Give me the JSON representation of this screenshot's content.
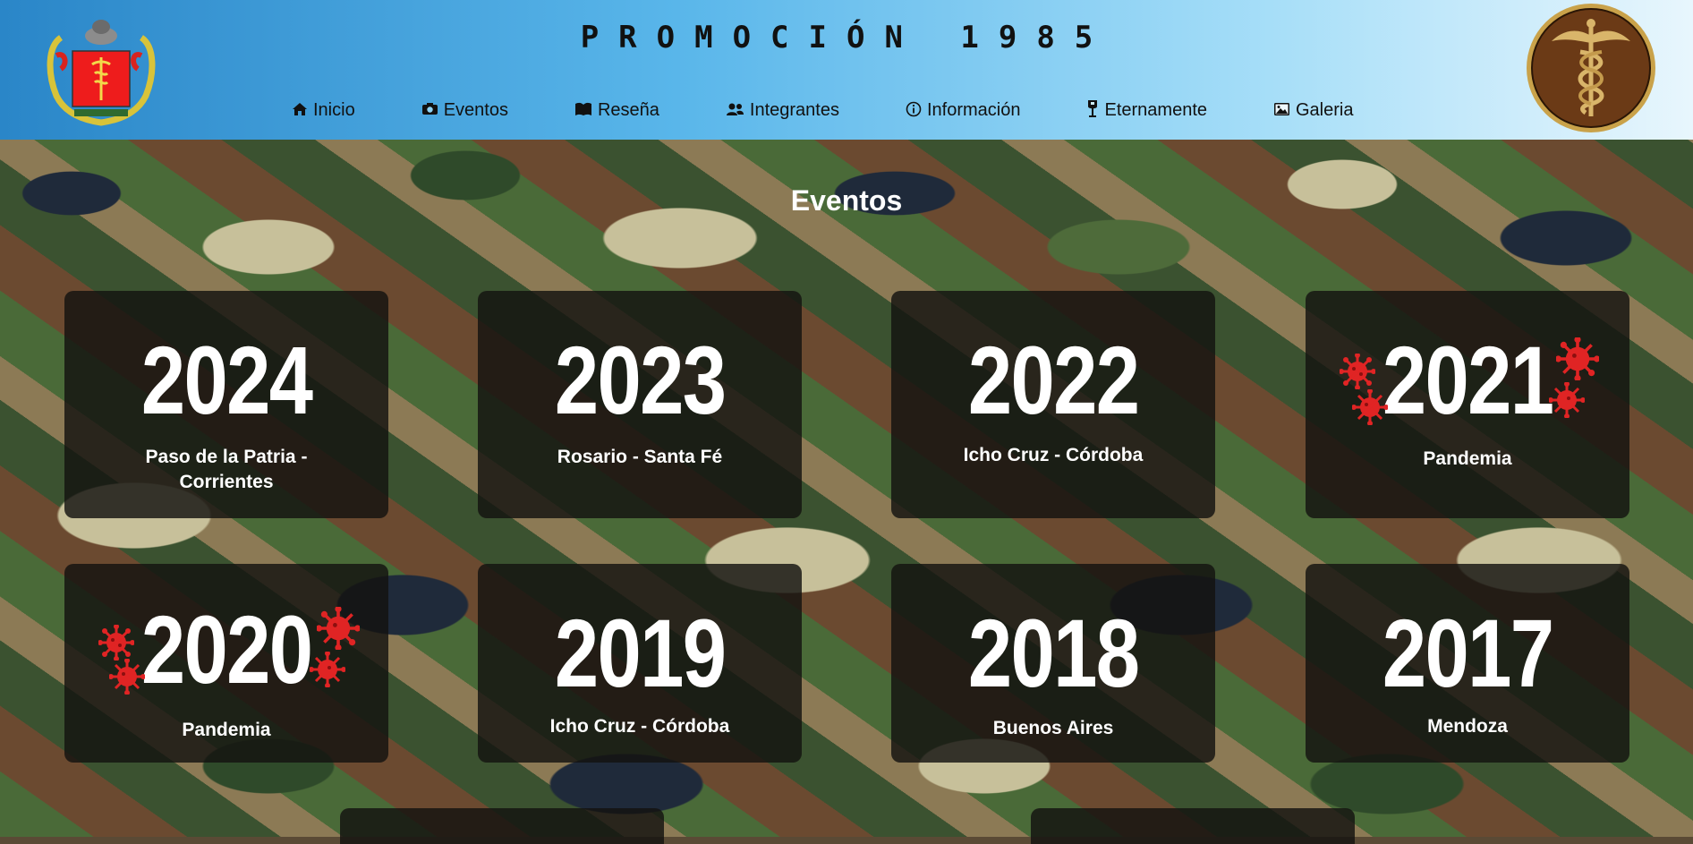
{
  "header": {
    "title": "PROMOCIÓN 1985",
    "nav": [
      {
        "label": "Inicio",
        "icon": "home-icon"
      },
      {
        "label": "Eventos",
        "icon": "camera-icon"
      },
      {
        "label": "Reseña",
        "icon": "book-icon"
      },
      {
        "label": "Integrantes",
        "icon": "users-icon"
      },
      {
        "label": "Información",
        "icon": "info-icon"
      },
      {
        "label": "Eternamente",
        "icon": "memorial-icon"
      },
      {
        "label": "Galeria",
        "icon": "image-icon"
      }
    ]
  },
  "main": {
    "heading": "Eventos",
    "events": [
      {
        "year": "2024",
        "place": "Paso de la Patria - Corrientes",
        "pandemic": false
      },
      {
        "year": "2023",
        "place": "Rosario - Santa Fé",
        "pandemic": false
      },
      {
        "year": "2022",
        "place": "Icho Cruz - Córdoba",
        "pandemic": false
      },
      {
        "year": "2021",
        "place": "Pandemia",
        "pandemic": true
      },
      {
        "year": "2020",
        "place": "Pandemia",
        "pandemic": true
      },
      {
        "year": "2019",
        "place": "Icho Cruz - Córdoba",
        "pandemic": false
      },
      {
        "year": "2018",
        "place": "Buenos Aires",
        "pandemic": false
      },
      {
        "year": "2017",
        "place": "Mendoza",
        "pandemic": false
      }
    ]
  },
  "colors": {
    "card_bg": "#141210",
    "virus": "#e02424",
    "header_start": "#2a86c8",
    "header_end": "#e8f6fd"
  }
}
